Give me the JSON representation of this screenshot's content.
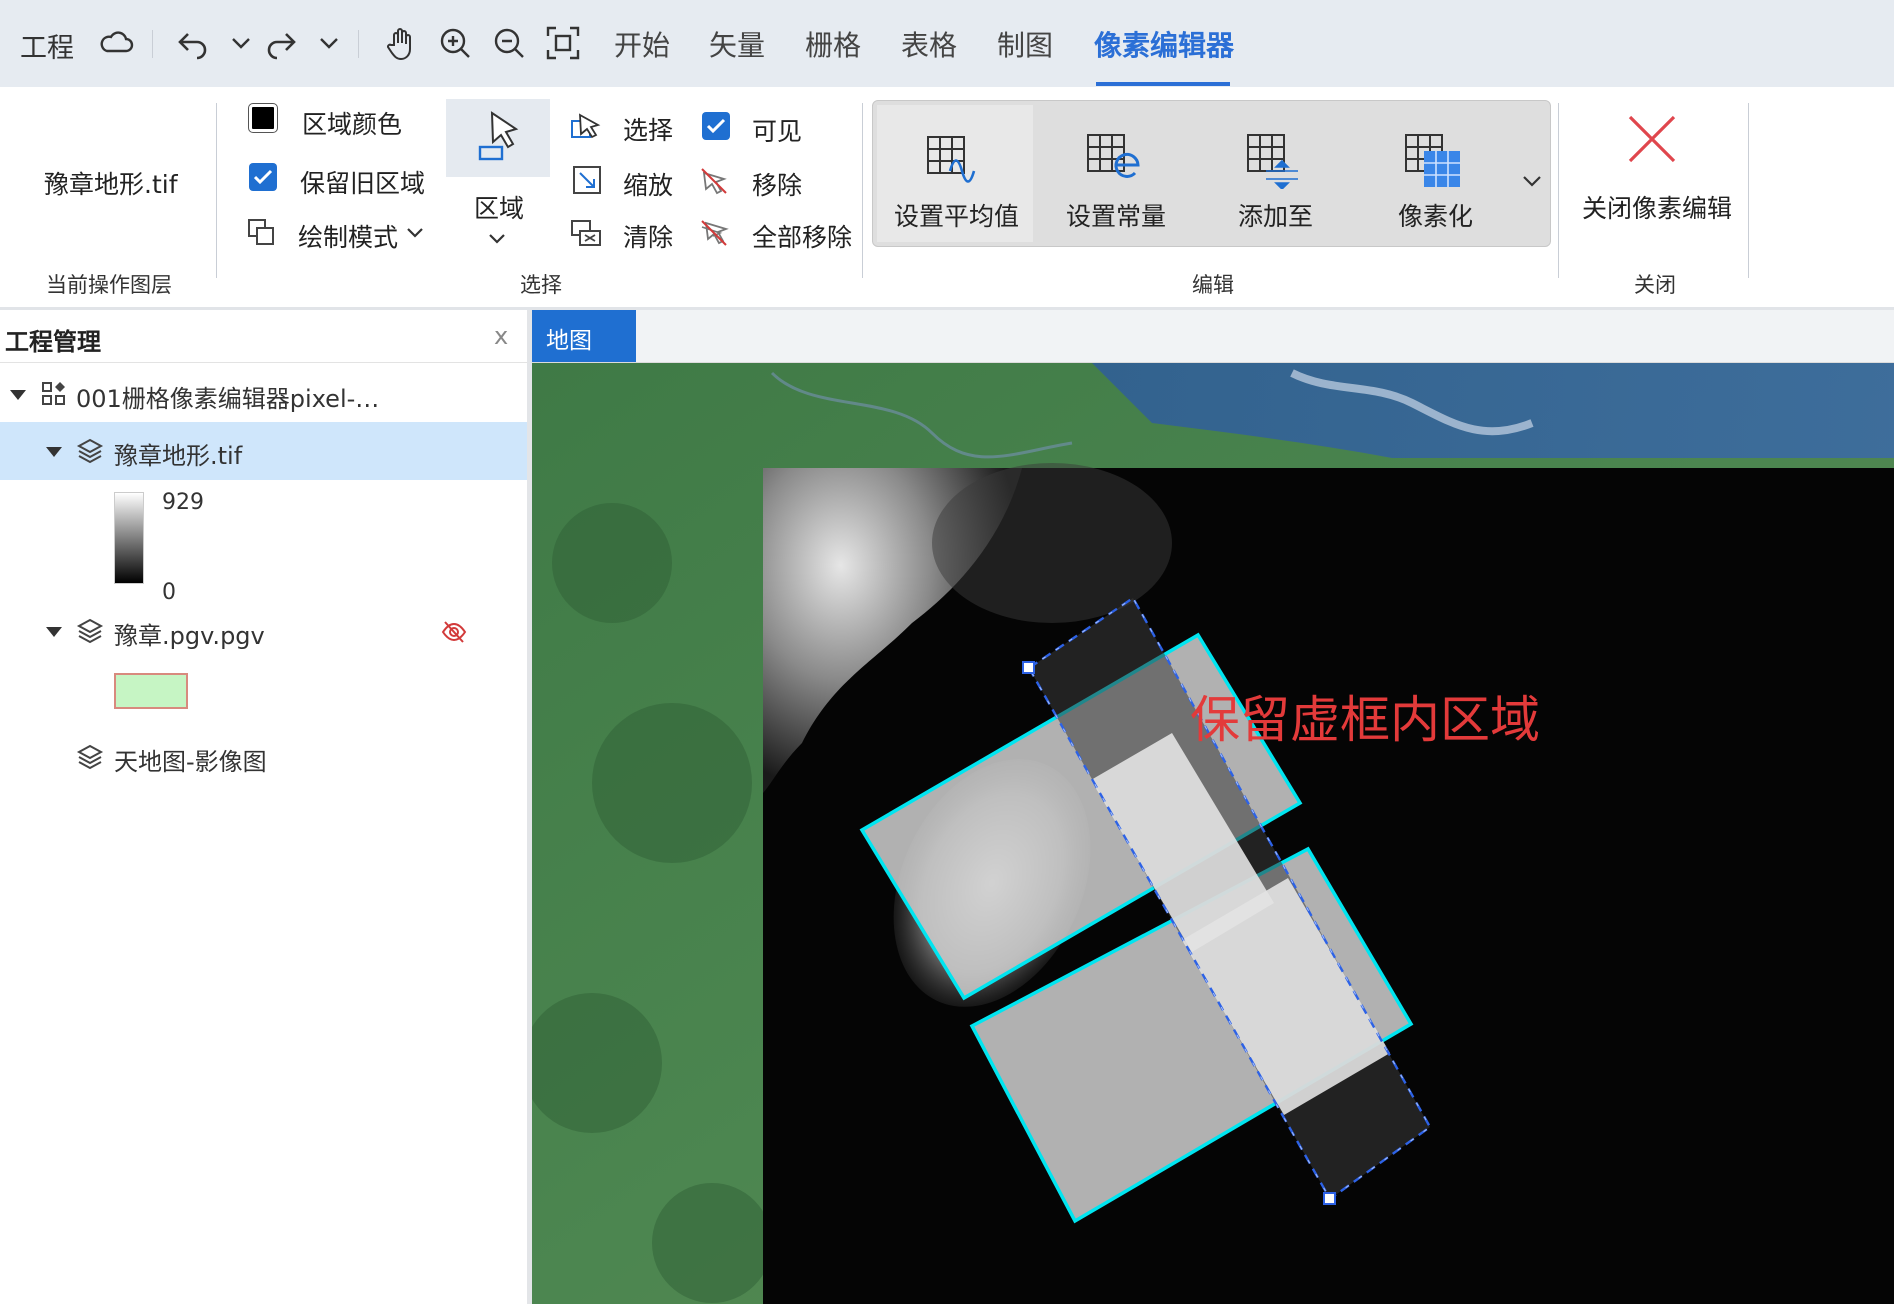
{
  "menubar": {
    "project": "工程",
    "tabs": [
      "开始",
      "矢量",
      "栅格",
      "表格",
      "制图",
      "像素编辑器"
    ],
    "active_tab": "像素编辑器"
  },
  "ribbon": {
    "current_layer": {
      "name": "豫章地形.tif",
      "group": "当前操作图层"
    },
    "select": {
      "group": "选择",
      "region_color": "区域颜色",
      "keep_old_region": "保留旧区域",
      "draw_mode": "绘制模式",
      "region": "区域",
      "select": "选择",
      "zoom": "缩放",
      "clear": "清除",
      "visible": "可见",
      "remove": "移除",
      "remove_all": "全部移除"
    },
    "edit": {
      "group": "编辑",
      "set_mean": "设置平均值",
      "set_constant": "设置常量",
      "add_to": "添加至",
      "pixelize": "像素化"
    },
    "close": {
      "group": "关闭",
      "close_editor": "关闭像素编辑"
    }
  },
  "panel": {
    "title": "工程管理",
    "close": "x",
    "project_name": "001栅格像素编辑器pixel-…",
    "layers": [
      {
        "name": "豫章地形.tif",
        "legend_max": "929",
        "legend_min": "0"
      },
      {
        "name": "豫章.pgv.pgv"
      },
      {
        "name": "天地图-影像图"
      }
    ]
  },
  "map": {
    "tab": "地图",
    "annotation": "保留虚框内区域"
  },
  "colors": {
    "accent": "#1f6fd1",
    "selection_outline": "#00e5f0",
    "annotation": "#e33a3a",
    "pgv_fill": "#c6f5c4"
  }
}
